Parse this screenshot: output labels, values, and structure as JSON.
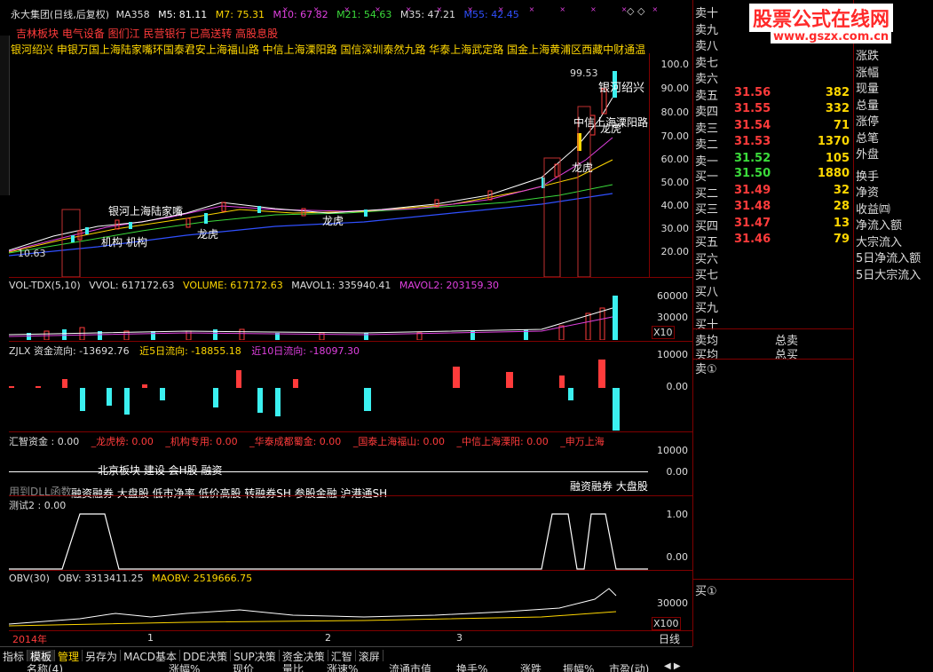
{
  "header": {
    "stock": "永大集团(日线,后复权)",
    "ma358": "MA358",
    "m5": "M5: 81.11",
    "m7": "M7: 75.31",
    "m10": "M10: 67.82",
    "m21": "M21: 54.63",
    "m35": "M35: 47.21",
    "m55": "M55: 42.45"
  },
  "sectors": "吉林板块 电气设备 图们江 民营银行 已高送转 高股息股",
  "brokers_line": "银河绍兴 申银万国上海陆家嘴环国泰君安上海福山路 中信上海溧阳路 国信深圳泰然九路 华泰上海武定路 国金上海黄浦区西藏中财通温岭",
  "main_chart": {
    "labels": {
      "high_price": "99.53",
      "low_price": "10.63",
      "yinhe": "银河绍兴",
      "zhongxin": "中信上海溧阳路",
      "longhu1": "龙虎",
      "longhu2": "龙虎",
      "longhu3": "龙虎",
      "longhu4": "龙虎",
      "yinhe_lujiazui": "银河上海陆家嘴",
      "jigou1": "机构",
      "jigou2": "机构"
    },
    "axis": [
      "100.0",
      "90.00",
      "80.00",
      "70.00",
      "60.00",
      "50.00",
      "40.00",
      "30.00",
      "20.00"
    ]
  },
  "volume_panel": {
    "title": "VOL-TDX(5,10)",
    "vvol": "VVOL: 617172.63",
    "volume": "VOLUME: 617172.63",
    "mavol1": "MAVOL1: 335940.41",
    "mavol2": "MAVOL2: 203159.30",
    "axis": [
      "60000",
      "30000"
    ],
    "unit": "X10"
  },
  "fund_panel": {
    "title": "ZJLX 资金流向: -13692.76",
    "d5": "近5日流向: -18855.18",
    "d10": "近10日流向: -18097.30",
    "axis": [
      "10000",
      "0.00"
    ]
  },
  "huizhi_panel": {
    "title": "汇智资金 : 0.00",
    "items": [
      "_龙虎榜: 0.00",
      "_机构专用: 0.00",
      "_华泰成都蜀金: 0.00",
      "_国泰上海福山: 0.00",
      "_中信上海溧阳: 0.00",
      "_申万上海"
    ],
    "axis": [
      "10000",
      "0.00"
    ],
    "overlay_a": "北京板块 建设 会H股 融资",
    "overlay_b": "融资融券 大盘股 低市净率 低价高股 转融券SH 参股金融 沪港通SH",
    "overlay_c": "融资融券 大盘股",
    "dll": "用到DLL函数"
  },
  "test_panel": {
    "title": "测试2 : 0.00",
    "axis": [
      "1.00",
      "0.00"
    ]
  },
  "obv_panel": {
    "title": "OBV(30)",
    "obv": "OBV: 3313411.25",
    "maobv": "MAOBV: 2519666.75",
    "axis": [
      "30000"
    ],
    "unit": "X100"
  },
  "time_axis": [
    "2014年",
    "1",
    "2",
    "3"
  ],
  "period_label": "日线",
  "bottom_tabs": [
    "指标",
    "模板",
    "管理",
    "另存为",
    "MACD基本",
    "DDE决策",
    "SUP决策",
    "资金决策",
    "汇智",
    "滚屏"
  ],
  "columns": [
    "名称(4)",
    "涨幅%",
    "现价",
    "量比",
    "涨速%",
    "流通市值",
    "换手%",
    "涨跌",
    "振幅%",
    "市盈(动)"
  ],
  "order_book": {
    "sell": [
      {
        "label": "卖十",
        "price": "",
        "vol": ""
      },
      {
        "label": "卖九",
        "price": "",
        "vol": ""
      },
      {
        "label": "卖八",
        "price": "",
        "vol": ""
      },
      {
        "label": "卖七",
        "price": "",
        "vol": ""
      },
      {
        "label": "卖六",
        "price": "",
        "vol": ""
      },
      {
        "label": "卖五",
        "price": "31.56",
        "vol": "382"
      },
      {
        "label": "卖四",
        "price": "31.55",
        "vol": "332"
      },
      {
        "label": "卖三",
        "price": "31.54",
        "vol": "71"
      },
      {
        "label": "卖二",
        "price": "31.53",
        "vol": "1370"
      },
      {
        "label": "卖一",
        "price": "31.52",
        "vol": "105"
      }
    ],
    "buy": [
      {
        "label": "买一",
        "price": "31.50",
        "vol": "1880"
      },
      {
        "label": "买二",
        "price": "31.49",
        "vol": "32"
      },
      {
        "label": "买三",
        "price": "31.48",
        "vol": "28"
      },
      {
        "label": "买四",
        "price": "31.47",
        "vol": "13"
      },
      {
        "label": "买五",
        "price": "31.46",
        "vol": "79"
      },
      {
        "label": "买六",
        "price": "",
        "vol": ""
      },
      {
        "label": "买七",
        "price": "",
        "vol": ""
      },
      {
        "label": "买八",
        "price": "",
        "vol": ""
      },
      {
        "label": "买九",
        "price": "",
        "vol": ""
      },
      {
        "label": "买十",
        "price": "",
        "vol": ""
      }
    ],
    "avg_sell": "卖均",
    "avg_buy": "买均",
    "total_sell": "总卖",
    "total_buy": "总买",
    "sell_circle": "卖①",
    "buy_circle": "买①"
  },
  "stats_panel": {
    "items": [
      "涨跌",
      "涨幅",
      "现量",
      "总量",
      "涨停",
      "总笔",
      "外盘",
      "换手",
      "净资",
      "收益㈣",
      "净流入额",
      "大宗流入",
      "5日净流入额",
      "5日大宗流入"
    ]
  },
  "watermark": {
    "title": "股票公式在线网",
    "url": "www.gszx.com.cn"
  },
  "colors": {
    "red": "#ff3b3b",
    "cyan": "#3bf0f0",
    "yellow": "#ffd700",
    "green": "#3bdb3b",
    "magenta": "#e040e0",
    "blue": "#3050ff",
    "border": "#800000"
  }
}
